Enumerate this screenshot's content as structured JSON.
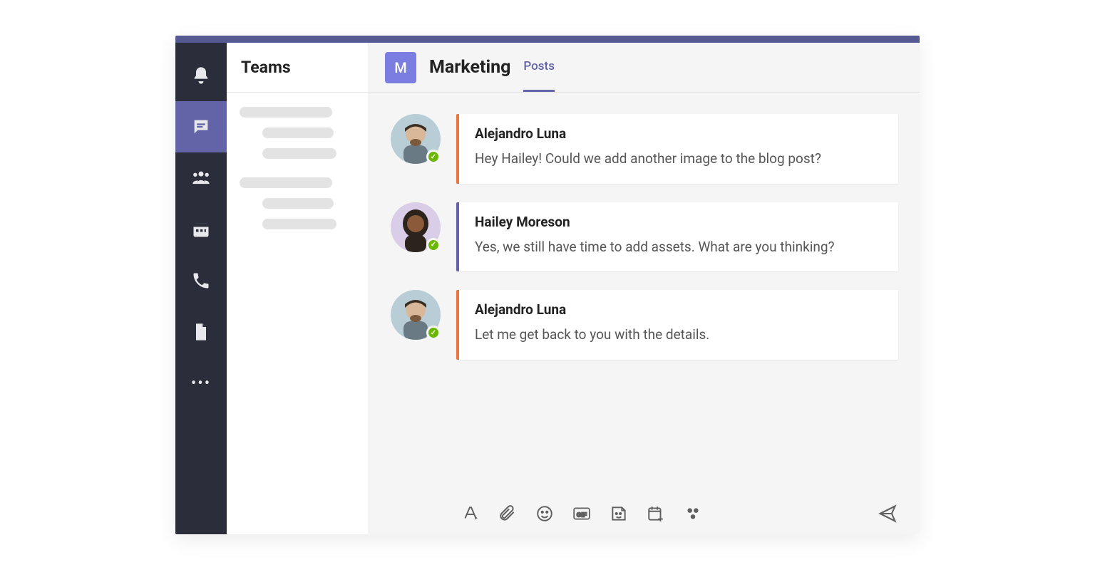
{
  "sidebar": {
    "title": "Teams"
  },
  "channel": {
    "initial": "M",
    "name": "Marketing",
    "tab_label": "Posts"
  },
  "posts": [
    {
      "author": "Alejandro Luna",
      "message": "Hey Hailey! Could we add another image to the blog post?",
      "accent": "orange",
      "avatar_bg": "#b9cdd6",
      "avatar_variant": "m1"
    },
    {
      "author": "Hailey Moreson",
      "message": "Yes, we still have time to add assets. What are you thinking?",
      "accent": "purple",
      "avatar_bg": "#d9cde8",
      "avatar_variant": "f1"
    },
    {
      "author": "Alejandro Luna",
      "message": "Let me get back to you with the details.",
      "accent": "orange",
      "avatar_bg": "#b9cdd6",
      "avatar_variant": "m1"
    }
  ],
  "rail": {
    "items": [
      "activity",
      "chat",
      "teams",
      "calendar",
      "calls",
      "files",
      "more"
    ]
  },
  "compose": {
    "icons": [
      "format",
      "attach",
      "emoji",
      "gif",
      "sticker",
      "schedule",
      "apps",
      "send"
    ]
  }
}
